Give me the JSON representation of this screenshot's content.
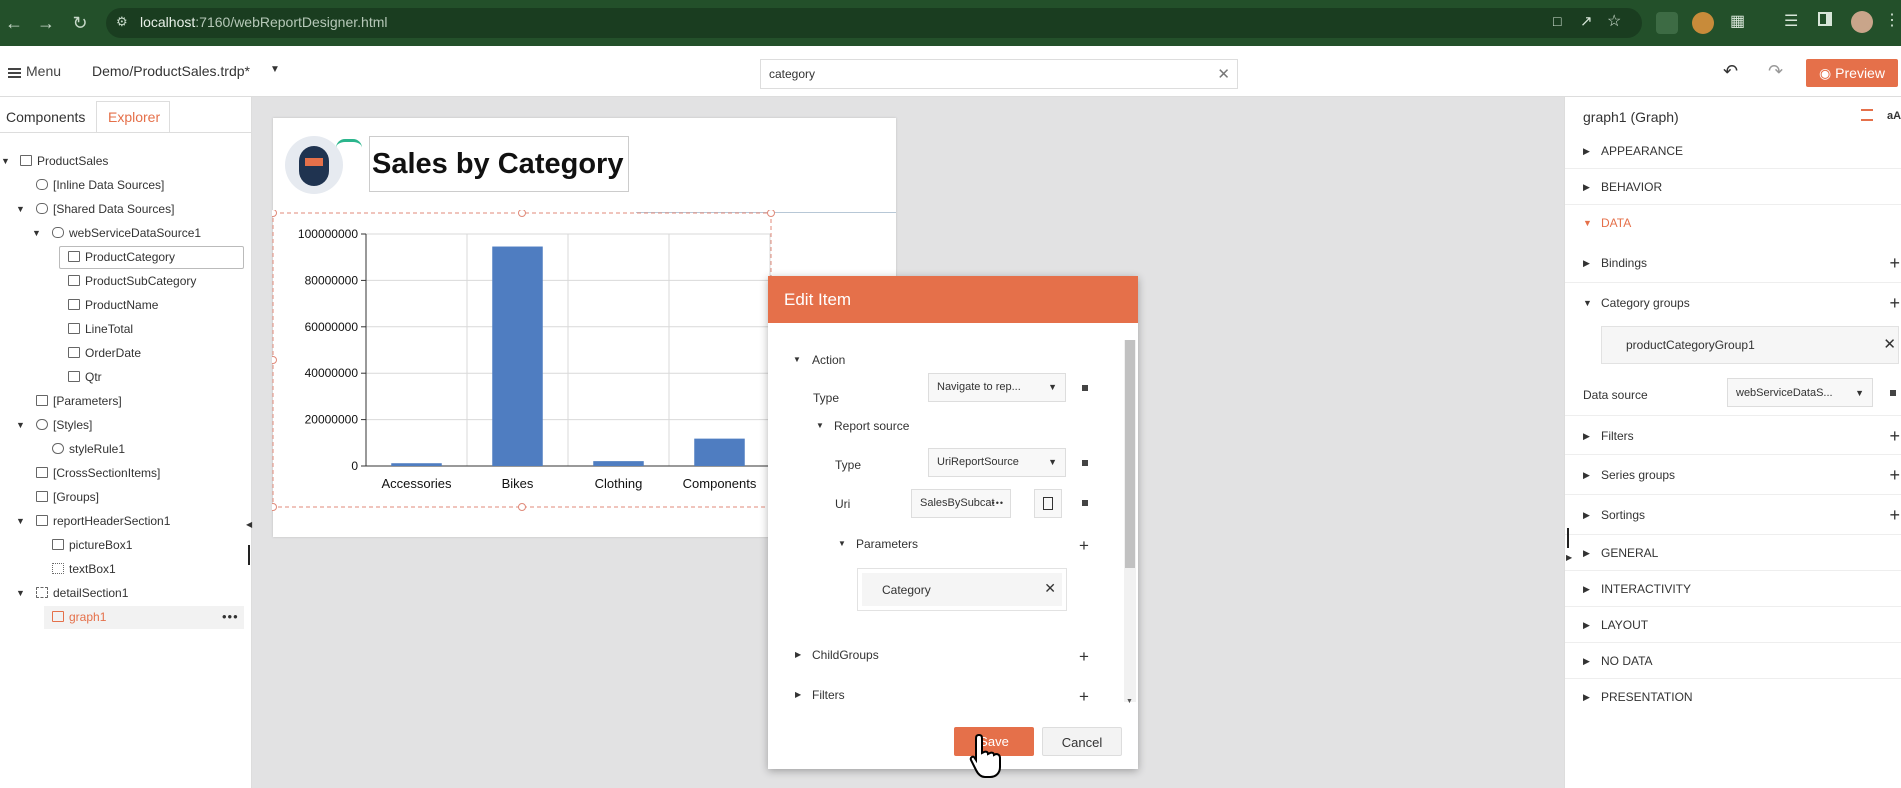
{
  "browser": {
    "url_host": "localhost",
    "url_rest": ":7160/webReportDesigner.html"
  },
  "app": {
    "menu_label": "Menu",
    "document": "Demo/ProductSales.trdp*",
    "search_value": "category",
    "preview_label": "Preview"
  },
  "left_panel": {
    "tabs": [
      "Components",
      "Explorer"
    ],
    "active_tab": "Explorer",
    "tree": [
      {
        "label": "ProductSales"
      },
      {
        "label": "[Inline Data Sources]"
      },
      {
        "label": "[Shared Data Sources]"
      },
      {
        "label": "webServiceDataSource1"
      },
      {
        "label": "ProductCategory"
      },
      {
        "label": "ProductSubCategory"
      },
      {
        "label": "ProductName"
      },
      {
        "label": "LineTotal"
      },
      {
        "label": "OrderDate"
      },
      {
        "label": "Qtr"
      },
      {
        "label": "[Parameters]"
      },
      {
        "label": "[Styles]"
      },
      {
        "label": "styleRule1"
      },
      {
        "label": "[CrossSectionItems]"
      },
      {
        "label": "[Groups]"
      },
      {
        "label": "reportHeaderSection1"
      },
      {
        "label": "pictureBox1"
      },
      {
        "label": "textBox1"
      },
      {
        "label": "detailSection1"
      },
      {
        "label": "graph1"
      }
    ]
  },
  "report": {
    "title": "Sales by Category"
  },
  "chart_data": {
    "type": "bar",
    "categories": [
      "Accessories",
      "Bikes",
      "Clothing",
      "Components"
    ],
    "values": [
      1200000,
      94600000,
      2100000,
      11800000
    ],
    "ylim": [
      0,
      100000000
    ],
    "yticks": [
      "100000000",
      "80000000",
      "60000000",
      "40000000",
      "20000000",
      "0"
    ],
    "bar_color": "#4f7dc1",
    "grid": true
  },
  "modal": {
    "title": "Edit Item",
    "action_label": "Action",
    "type_label": "Type",
    "type_value": "Navigate to rep...",
    "report_source_label": "Report source",
    "rs_type_label": "Type",
    "rs_type_value": "UriReportSource",
    "uri_label": "Uri",
    "uri_value": "SalesBySubcat",
    "uri_more": "•••",
    "parameters_label": "Parameters",
    "parameter_item": "Category",
    "childgroups_label": "ChildGroups",
    "filters_label": "Filters",
    "save_label": "Save",
    "cancel_label": "Cancel"
  },
  "right_panel": {
    "title": "graph1 (Graph)",
    "text_size_label": "aA",
    "sections": [
      {
        "label": "APPEARANCE",
        "expanded": false
      },
      {
        "label": "BEHAVIOR",
        "expanded": false
      },
      {
        "label": "DATA",
        "expanded": true
      }
    ],
    "data_rows": {
      "bindings": "Bindings",
      "category_groups": "Category groups",
      "category_group_item": "productCategoryGroup1",
      "data_source_label": "Data source",
      "data_source_value": "webServiceDataS...",
      "filters": "Filters",
      "series_groups": "Series groups",
      "sortings": "Sortings"
    },
    "more_sections": [
      "GENERAL",
      "INTERACTIVITY",
      "LAYOUT",
      "NO DATA",
      "PRESENTATION"
    ]
  },
  "colors": {
    "accent": "#e5704a",
    "browser_bar": "#23502a"
  }
}
